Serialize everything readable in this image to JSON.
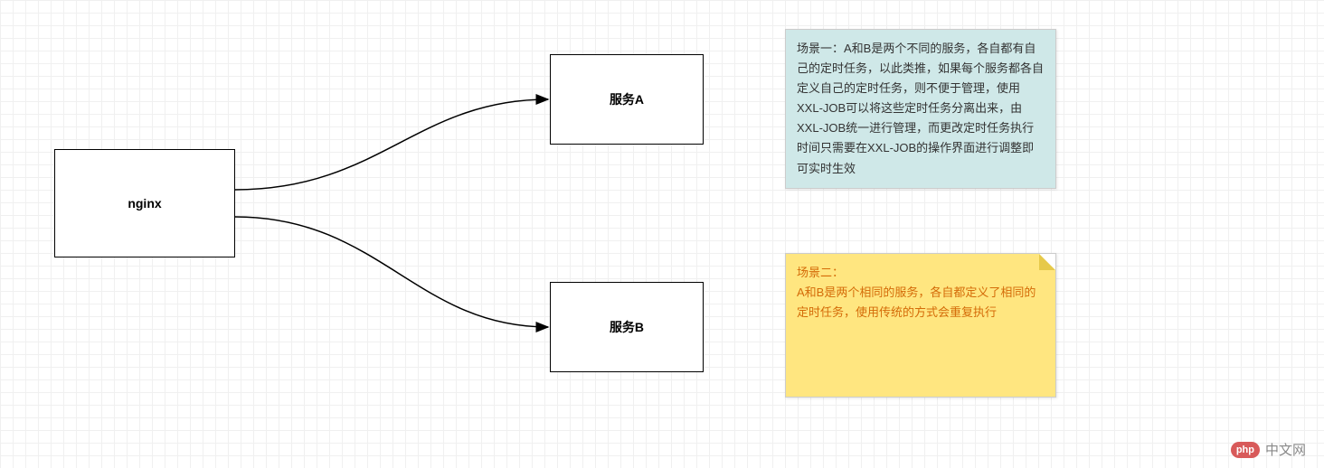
{
  "nodes": {
    "nginx": "nginx",
    "service_a": "服务A",
    "service_b": "服务B"
  },
  "notes": {
    "scenario1": "场景一：A和B是两个不同的服务，各自都有自己的定时任务，以此类推，如果每个服务都各自定义自己的定时任务，则不便于管理，使用XXL-JOB可以将这些定时任务分离出来，由XXL-JOB统一进行管理，而更改定时任务执行时间只需要在XXL-JOB的操作界面进行调整即可实时生效",
    "scenario2_title": "场景二：",
    "scenario2_body": "A和B是两个相同的服务，各自都定义了相同的定时任务，使用传统的方式会重复执行"
  },
  "watermark": {
    "badge": "php",
    "text": "中文网"
  }
}
